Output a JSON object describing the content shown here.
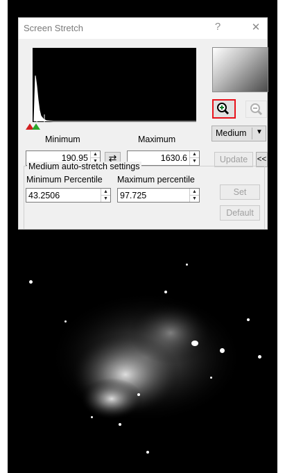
{
  "window": {
    "title": "Screen Stretch",
    "help_glyph": "?",
    "close_glyph": "✕"
  },
  "range": {
    "minimum_label": "Minimum",
    "maximum_label": "Maximum",
    "minimum_value": "190.95",
    "maximum_value": "1630.6"
  },
  "buttons": {
    "preset": "Medium",
    "update": "Update",
    "collapse": "<<",
    "set": "Set",
    "default": "Default",
    "swap_glyph": "⇄"
  },
  "auto_stretch": {
    "group_label": "Medium auto-stretch settings",
    "min_percentile_label": "Minimum Percentile",
    "max_percentile_label": "Maximum percentile",
    "min_percentile_value": "43.2506",
    "max_percentile_value": "97.725"
  },
  "icons": {
    "zoom_in": "zoom-in-icon",
    "zoom_out": "zoom-out-icon",
    "min_marker": "red-triangle-marker",
    "max_marker": "green-triangle-marker"
  },
  "colors": {
    "zoom_highlight": "#e8111a",
    "min_marker": "#d21f1f",
    "max_marker": "#2aa52a"
  }
}
